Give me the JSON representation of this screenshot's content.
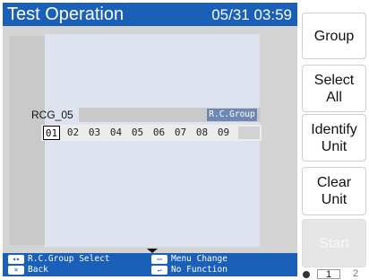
{
  "header": {
    "title": "Test Operation",
    "datetime": "05/31 03:59"
  },
  "group": {
    "label": "RCG_05",
    "tag": "R.C.Group"
  },
  "units": [
    "01",
    "02",
    "03",
    "04",
    "05",
    "06",
    "07",
    "08",
    "09"
  ],
  "selected_unit": "01",
  "help": {
    "rc_group_select": "R.C.Group Select",
    "menu_change": "Menu Change",
    "back": "Back",
    "no_function": "No Function"
  },
  "buttons": {
    "group": "Group",
    "select_all": [
      "Select",
      "All"
    ],
    "identify_unit": [
      "Identify",
      "Unit"
    ],
    "clear_unit": [
      "Clear",
      "Unit"
    ],
    "start": "Start"
  },
  "pager": {
    "current": "1",
    "next": "2"
  }
}
